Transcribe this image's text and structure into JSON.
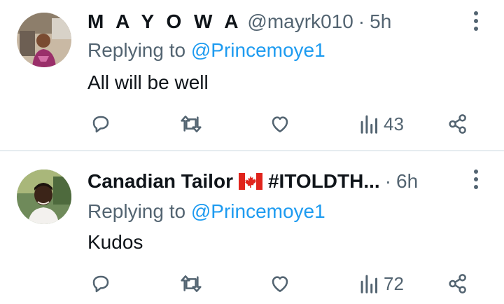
{
  "tweets": [
    {
      "name": "M A Y O W A",
      "handle": "@mayrk010",
      "separator": "·",
      "time": "5h",
      "replying_prefix": "Replying to",
      "replying_to": "@Princemoye1",
      "text": "All will be well",
      "views": "43"
    },
    {
      "name": "Canadian Tailor",
      "flag": "canada-flag",
      "name_suffix": "#ITOLDTH...",
      "separator": "·",
      "time": "6h",
      "replying_prefix": "Replying to",
      "replying_to": "@Princemoye1",
      "text": "Kudos",
      "views": "72"
    }
  ],
  "icons": [
    "reply-icon",
    "retweet-icon",
    "like-icon",
    "views-icon",
    "share-icon",
    "more-options-icon"
  ],
  "colors": {
    "text": "#0f1419",
    "secondary": "#536471",
    "accent": "#1d9bf0",
    "divider": "#e6ecf0"
  }
}
